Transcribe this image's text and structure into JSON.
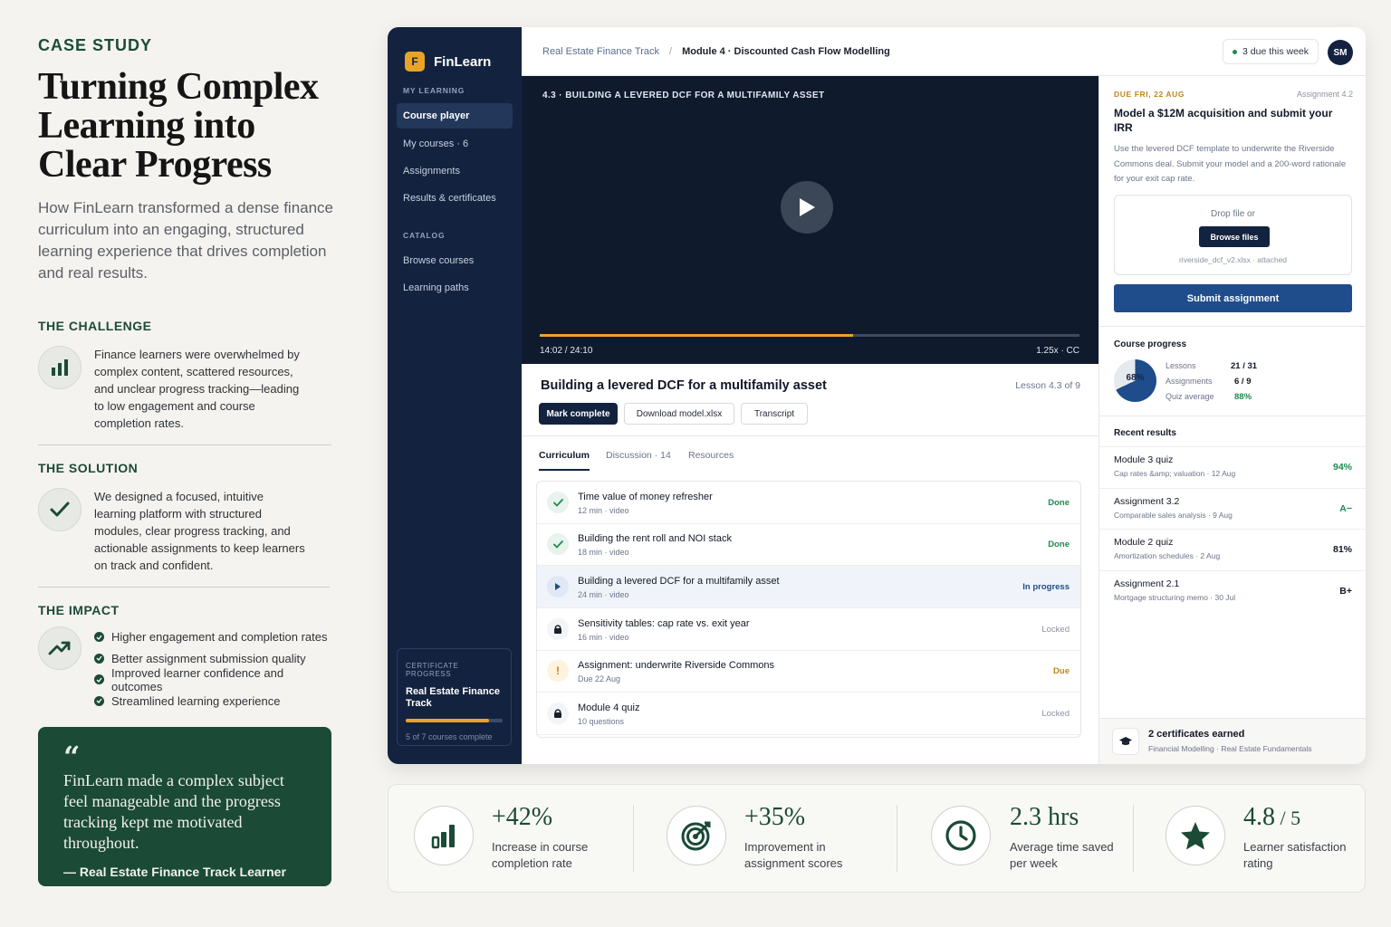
{
  "case_study": {
    "eyebrow": "CASE STUDY",
    "title": "Turning Complex Learning into Clear Progress",
    "subtitle": "How FinLearn transformed a dense finance curriculum into an engaging, structured learning experience that drives completion and real results.",
    "challenge_heading": "THE CHALLENGE",
    "challenge_text": "Finance learners were overwhelmed by complex content, scattered resources, and unclear progress tracking—leading to low engagement and course completion rates.",
    "solution_heading": "THE SOLUTION",
    "solution_text": "We designed a focused, intuitive learning platform with structured modules, clear progress tracking, and actionable assignments to keep learners on track and confident.",
    "impact_heading": "THE IMPACT",
    "impact_items": [
      "Higher engagement and completion rates",
      "Better assignment submission quality",
      "Improved learner confidence and outcomes",
      "Streamlined learning experience"
    ],
    "quote_mark": "“",
    "quote": "FinLearn made a complex subject feel manageable and the progress tracking kept me motivated throughout.",
    "quote_author": "— Real Estate Finance Track Learner"
  },
  "app": {
    "logo_letter": "F",
    "brand": "FinLearn",
    "nav_heading_1": "MY LEARNING",
    "nav_items_1": [
      "Course player",
      "My courses · 6",
      "Assignments",
      "Results & certificates"
    ],
    "nav_heading_2": "CATALOG",
    "nav_items_2": [
      "Browse courses",
      "Learning paths"
    ],
    "cert_heading": "CERTIFICATE PROGRESS",
    "cert_title": "Real Estate Finance Track",
    "cert_status": "5 of 7 courses complete",
    "cert_progress": 0.86,
    "breadcrumb_root": "Real Estate Finance Track",
    "breadcrumb_sep": "/",
    "breadcrumb_current": "Module 4 · Discounted Cash Flow Modelling",
    "due_label": "3 due this week",
    "avatar_initials": "SM",
    "video": {
      "title": "4.3 · BUILDING A LEVERED DCF FOR A MULTIFAMILY ASSET",
      "time": "14:02 / 24:10",
      "controls": "1.25x · CC",
      "progress": 0.58
    },
    "lesson": {
      "title": "Building a levered DCF for a multifamily asset",
      "meta": "Lesson 4.3 of 9",
      "btn_complete": "Mark complete",
      "btn_download": "Download model.xlsx",
      "btn_transcript": "Transcript"
    },
    "tabs": [
      "Curriculum",
      "Discussion · 14",
      "Resources"
    ],
    "curriculum": [
      {
        "title": "Time value of money refresher",
        "sub": "12 min · video",
        "status": "Done",
        "kind": "done"
      },
      {
        "title": "Building the rent roll and NOI stack",
        "sub": "18 min · video",
        "status": "Done",
        "kind": "done"
      },
      {
        "title": "Building a levered DCF for a multifamily asset",
        "sub": "24 min · video",
        "status": "In progress",
        "kind": "progress"
      },
      {
        "title": "Sensitivity tables: cap rate vs. exit year",
        "sub": "16 min · video",
        "status": "Locked",
        "kind": "locked"
      },
      {
        "title": "Assignment: underwrite Riverside Commons",
        "sub": "Due 22 Aug",
        "status": "Due",
        "kind": "due"
      },
      {
        "title": "Module 4 quiz",
        "sub": "10 questions",
        "status": "Locked",
        "kind": "locked"
      }
    ],
    "assignment": {
      "due": "DUE FRI, 22 AUG",
      "number": "Assignment 4.2",
      "title": "Model a $12M acquisition and submit your IRR",
      "desc": "Use the levered DCF template to underwrite the Riverside Commons deal. Submit your model and a 200-word rationale for your exit cap rate.",
      "drop_text": "Drop file or",
      "browse": "Browse files",
      "file": "riverside_dcf_v2.xlsx · attached",
      "submit": "Submit assignment"
    },
    "course_progress": {
      "heading": "Course progress",
      "percent_label": "68%",
      "percent": 0.68,
      "stats": [
        {
          "label": "Lessons",
          "value": "21 / 31"
        },
        {
          "label": "Assignments",
          "value": "6 / 9"
        },
        {
          "label": "Quiz average",
          "value": "88%"
        }
      ]
    },
    "recent_results": {
      "heading": "Recent results",
      "items": [
        {
          "title": "Module 3 quiz",
          "sub": "Cap rates &amp; valuation · 12 Aug",
          "grade": "94%",
          "color": "#1f8a50"
        },
        {
          "title": "Assignment 3.2",
          "sub": "Comparable sales analysis · 9 Aug",
          "grade": "A−",
          "color": "#1f8a50"
        },
        {
          "title": "Module 2 quiz",
          "sub": "Amortization schedules · 2 Aug",
          "grade": "81%",
          "color": "#111827"
        },
        {
          "title": "Assignment 2.1",
          "sub": "Mortgage structuring memo · 30 Jul",
          "grade": "B+",
          "color": "#111827"
        }
      ]
    },
    "certificates": {
      "title": "2 certificates earned",
      "sub": "Financial Modelling · Real Estate Fundamentals"
    }
  },
  "stats": [
    {
      "value": "+42%",
      "label": "Increase in course completion rate",
      "icon": "bar-chart-icon"
    },
    {
      "value": "+35%",
      "label": "Improvement in assignment scores",
      "icon": "target-icon"
    },
    {
      "value": "2.3 hrs",
      "label": "Average time saved per week",
      "icon": "clock-icon"
    },
    {
      "value": "4.8",
      "value_suffix": " / 5",
      "label": "Learner satisfaction rating",
      "icon": "star-icon"
    }
  ],
  "colors": {
    "brand_green": "#1b4a36",
    "navy": "#13233f",
    "accent_orange": "#e9a428",
    "primary_blue": "#1f4c8a",
    "success_green": "#1f8a50"
  }
}
